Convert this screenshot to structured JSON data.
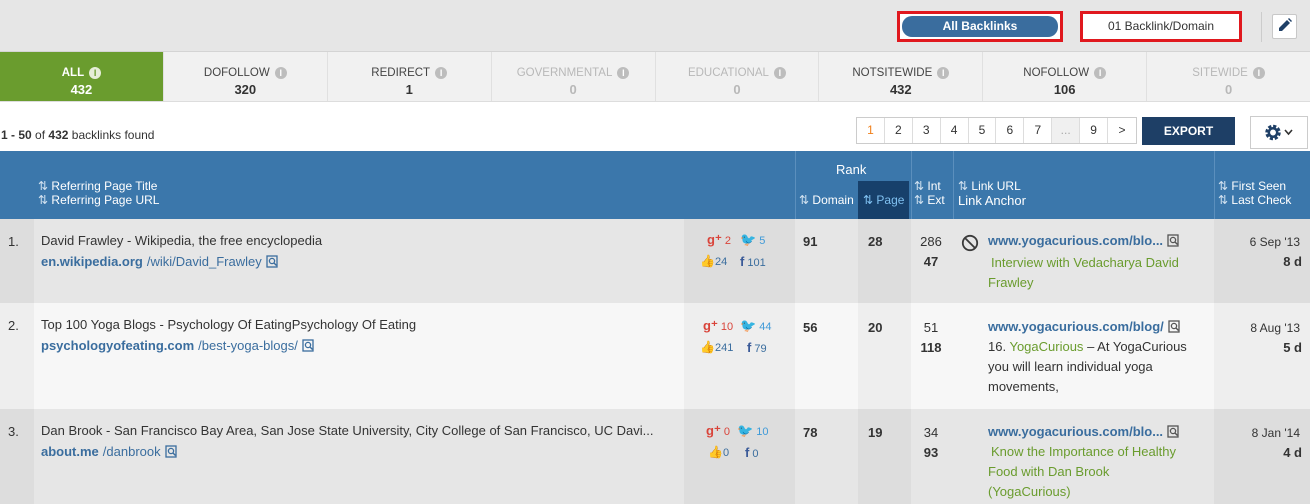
{
  "toolbar": {
    "all_backlinks": "All Backlinks",
    "one_per_domain": "01 Backlink/Domain"
  },
  "tabs": [
    {
      "label": "ALL",
      "count": "432",
      "state": "active"
    },
    {
      "label": "DOFOLLOW",
      "count": "320",
      "state": "normal"
    },
    {
      "label": "REDIRECT",
      "count": "1",
      "state": "normal"
    },
    {
      "label": "GOVERNMENTAL",
      "count": "0",
      "state": "disabled"
    },
    {
      "label": "EDUCATIONAL",
      "count": "0",
      "state": "disabled"
    },
    {
      "label": "NOTSITEWIDE",
      "count": "432",
      "state": "normal"
    },
    {
      "label": "NOFOLLOW",
      "count": "106",
      "state": "normal"
    },
    {
      "label": "SITEWIDE",
      "count": "0",
      "state": "disabled"
    }
  ],
  "results": {
    "range": "1 - 50",
    "of": "of",
    "total": "432",
    "suffix": "backlinks found"
  },
  "pagination": {
    "pages": [
      "1",
      "2",
      "3",
      "4",
      "5",
      "6",
      "7",
      "...",
      "9",
      ">"
    ],
    "current": "1"
  },
  "export_label": "EXPORT",
  "header": {
    "ref_title": "Referring Page Title",
    "ref_url": "Referring Page URL",
    "rank": "Rank",
    "domain": "Domain",
    "page": "Page",
    "int": "Int",
    "ext": "Ext",
    "link_url": "Link URL",
    "link_anchor": "Link Anchor",
    "first_seen": "First Seen",
    "last_check": "Last Check"
  },
  "rows": [
    {
      "index": "1.",
      "title": "David Frawley - Wikipedia, the free encyclopedia",
      "url_domain": "en.wikipedia.org",
      "url_path": "/wiki/David_Frawley",
      "gplus": "2",
      "twitter": "5",
      "likes": "24",
      "facebook": "101",
      "domain_rank": "91",
      "page_rank": "28",
      "int": "286",
      "ext": "47",
      "link_url": "www.yogacurious.com/blo...",
      "anchor_lines": [
        "Interview with Vedacharya David",
        "Frawley"
      ],
      "first_seen": "6 Sep '13",
      "last_check": "8 d"
    },
    {
      "index": "2.",
      "title": "Top 100 Yoga Blogs - Psychology Of EatingPsychology Of Eating",
      "url_domain": "psychologyofeating.com",
      "url_path": "/best-yoga-blogs/",
      "gplus": "10",
      "twitter": "44",
      "likes": "241",
      "facebook": "79",
      "domain_rank": "56",
      "page_rank": "20",
      "int": "51",
      "ext": "118",
      "link_url": "www.yogacurious.com/blog/",
      "anchor_prefix": "16.",
      "anchor_green": "YogaCurious",
      "anchor_rest": "– At YogaCurious",
      "anchor_more": [
        "you will learn individual yoga",
        "movements,"
      ],
      "first_seen": "8 Aug '13",
      "last_check": "5 d"
    },
    {
      "index": "3.",
      "title": "Dan Brook - San Francisco Bay Area, San Jose State University, City College of San Francisco, UC Davi...",
      "url_domain": "about.me",
      "url_path": "/danbrook",
      "gplus": "0",
      "twitter": "10",
      "likes": "0",
      "facebook": "0",
      "domain_rank": "78",
      "page_rank": "19",
      "int": "34",
      "ext": "93",
      "link_url": "www.yogacurious.com/blo...",
      "anchor_lines": [
        "Know the Importance of Healthy",
        "Food with Dan Brook",
        "(YogaCurious)"
      ],
      "first_seen": "8 Jan '14",
      "last_check": "4 d"
    }
  ]
}
